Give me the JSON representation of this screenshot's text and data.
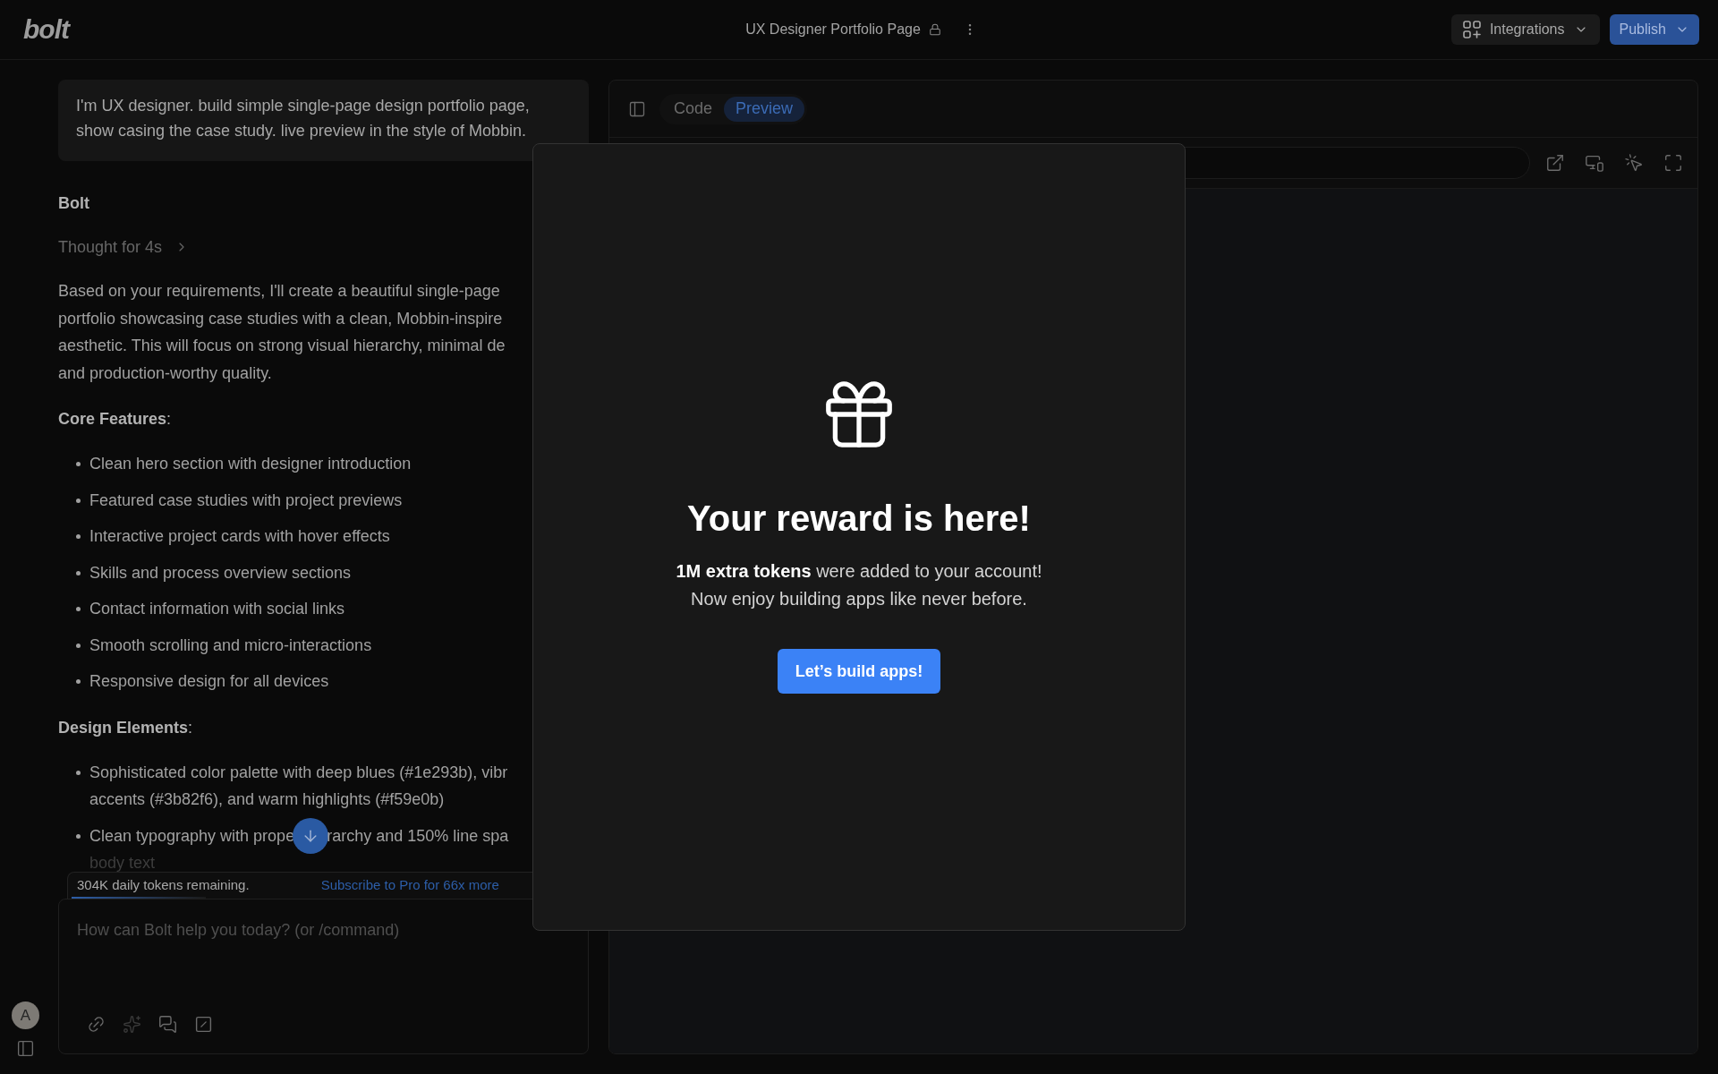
{
  "top_bar": {
    "logo": "bolt",
    "project_title": "UX Designer Portfolio Page",
    "integrations_button": "Integrations",
    "publish_button": "Publish"
  },
  "chat": {
    "user_message_lines": [
      "I'm UX designer. build simple single-page design portfolio page,",
      "show casing the case study. live preview in the style of Mobbin."
    ],
    "assistant_name": "Bolt",
    "thought": {
      "label": "Thought for 4s",
      "expanded": false
    },
    "intro_lines": [
      "Based on your requirements, I'll create a beautiful single-page",
      "portfolio showcasing case studies with a clean, Mobbin-inspire",
      "aesthetic. This will focus on strong visual hierarchy, minimal de",
      "and production-worthy quality."
    ],
    "sections": [
      {
        "heading": "**Core Features**:",
        "items": [
          {
            "lines": [
              [
                "Clean hero section with designer introduction"
              ]
            ]
          },
          {
            "lines": [
              [
                "Featured case studies with project previews"
              ]
            ]
          },
          {
            "lines": [
              [
                "Interactive project cards with hover effects"
              ]
            ]
          },
          {
            "lines": [
              [
                "Skills and process overview sections"
              ]
            ]
          },
          {
            "lines": [
              [
                "Contact information with social links"
              ]
            ]
          },
          {
            "lines": [
              [
                "Smooth scrolling and micro-interactions"
              ]
            ]
          },
          {
            "lines": [
              [
                "Responsive design for all devices"
              ]
            ]
          }
        ]
      },
      {
        "heading": "**Design Elements**:",
        "items": [
          {
            "lines": [
              [
                "Sophisticated color palette with deep blues (#1e293b), vibr"
              ],
              [
                "accents (#3b82f6), and warm highlights (#f59e0b)"
              ]
            ]
          },
          {
            "lines": [
              [
                "Clean typography with prope",
                "rarchy and 150% line spa"
              ],
              [
                "body text"
              ]
            ]
          }
        ]
      }
    ],
    "token_notice": {
      "text": "304K daily tokens remaining.",
      "link": "Subscribe to Pro for 66x more"
    },
    "input": {
      "placeholder": "How can Bolt help you today? (or /command)"
    },
    "user_avatar": "A"
  },
  "workspace": {
    "tabs": [
      {
        "label": "Code",
        "selected": false
      },
      {
        "label": "Preview",
        "selected": true
      }
    ]
  },
  "reward_dialog": {
    "title": "Your reward is here!",
    "message_lines": [
      "**1M extra tokens** were added to your account!",
      "Now enjoy building apps like never before."
    ],
    "button": "Let’s build apps!"
  }
}
